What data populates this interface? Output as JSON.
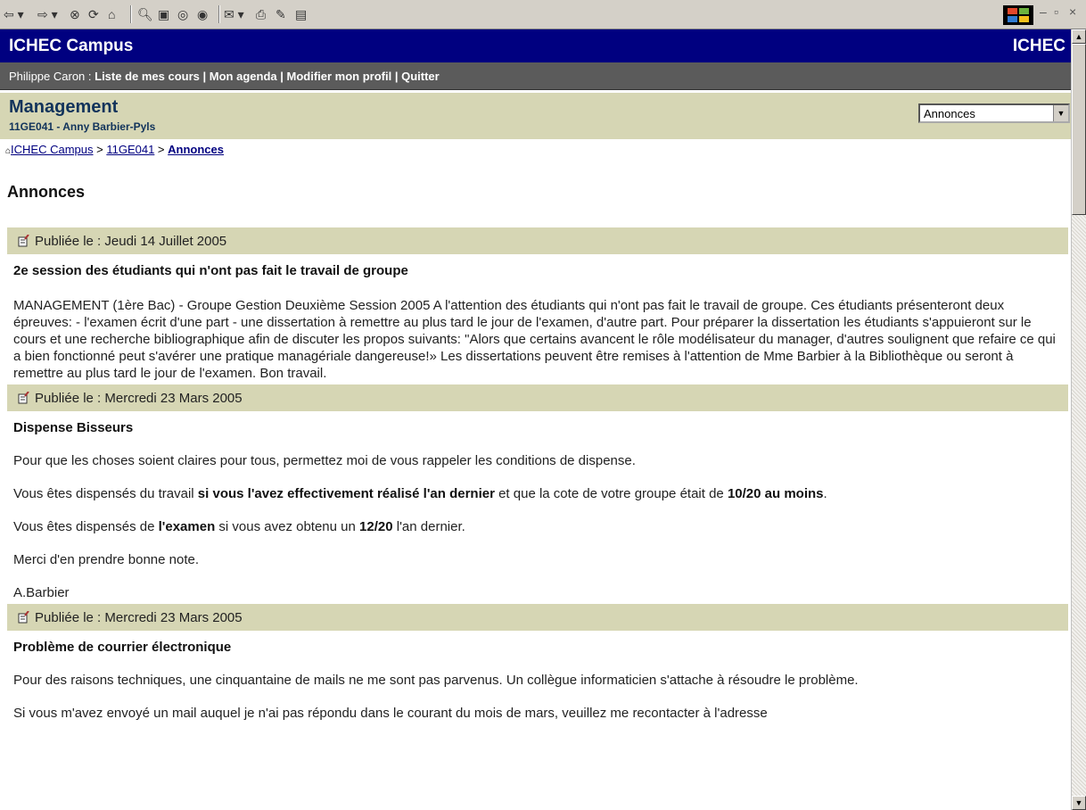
{
  "toolbar": {
    "buttons": [
      "back-icon",
      "forward-icon",
      "stop-icon",
      "refresh-icon",
      "home-icon",
      "search-icon",
      "favorites-icon",
      "history-icon",
      "media-icon",
      "mail-icon",
      "print-icon",
      "edit-icon",
      "discuss-icon"
    ]
  },
  "header": {
    "title": "ICHEC Campus",
    "brand": "ICHEC"
  },
  "userbar": {
    "name": "Philippe Caron : ",
    "links": [
      "Liste de mes cours",
      "Mon agenda",
      "Modifier mon profil",
      "Quitter"
    ],
    "separator": " | "
  },
  "course": {
    "title": "Management",
    "subtitle": "11GE041 - Anny Barbier-Pyls",
    "select_value": "Annonces"
  },
  "breadcrumb": {
    "home": "ICHEC Campus",
    "course": "11GE041",
    "current": "Annonces",
    "sep": " > "
  },
  "page_title": "Annonces",
  "announcements": [
    {
      "date": "Publiée le : Jeudi 14 Juillet 2005",
      "title": "2e session des étudiants qui n'ont pas fait le travail de groupe",
      "body": "MANAGEMENT (1ère Bac) - Groupe Gestion Deuxième Session 2005 A l'attention des étudiants qui n'ont pas fait le travail de groupe. Ces étudiants présenteront deux épreuves: - l'examen écrit d'une part - une dissertation à remettre au plus tard le jour de l'examen, d'autre part. Pour préparer la dissertation les étudiants s'appuieront sur le cours et une recherche bibliographique afin de discuter les propos suivants: \"Alors que certains avancent le rôle modélisateur du manager, d'autres soulignent que refaire ce qui a bien fonctionné peut s'avérer une pratique managériale dangereuse!» Les dissertations peuvent être remises à l'attention de Mme Barbier à la Bibliothèque ou seront à remettre au plus tard le jour de l'examen. Bon travail."
    },
    {
      "date": "Publiée le : Mercredi 23 Mars 2005",
      "title": "Dispense Bisseurs",
      "p1": "Pour que les choses soient claires pour tous, permettez moi de vous rappeler les conditions de dispense.",
      "p2a": "Vous êtes dispensés du travail ",
      "p2b": "si vous l'avez effectivement réalisé l'an dernier",
      "p2c": " et que la cote de votre groupe était de ",
      "p2d": "10/20 au moins",
      "p2e": ".",
      "p3a": "Vous êtes dispensés de ",
      "p3b": "l'examen",
      "p3c": " si vous avez obtenu un ",
      "p3d": "12/20",
      "p3e": " l'an dernier.",
      "p4": "Merci d'en prendre bonne note.",
      "p5": "A.Barbier"
    },
    {
      "date": "Publiée le : Mercredi 23 Mars 2005",
      "title": "Problème de courrier électronique",
      "p1": "Pour des raisons techniques, une cinquantaine de mails ne me sont pas parvenus. Un collègue informaticien s'attache à résoudre le problème.",
      "p2": "Si vous m'avez envoyé un mail auquel je n'ai pas répondu dans le courant du mois de mars, veuillez me recontacter à l'adresse"
    }
  ],
  "colors": {
    "header": "#000080",
    "userbar": "#5b5b5b",
    "band": "#d6d6b4",
    "link": "#000080"
  }
}
